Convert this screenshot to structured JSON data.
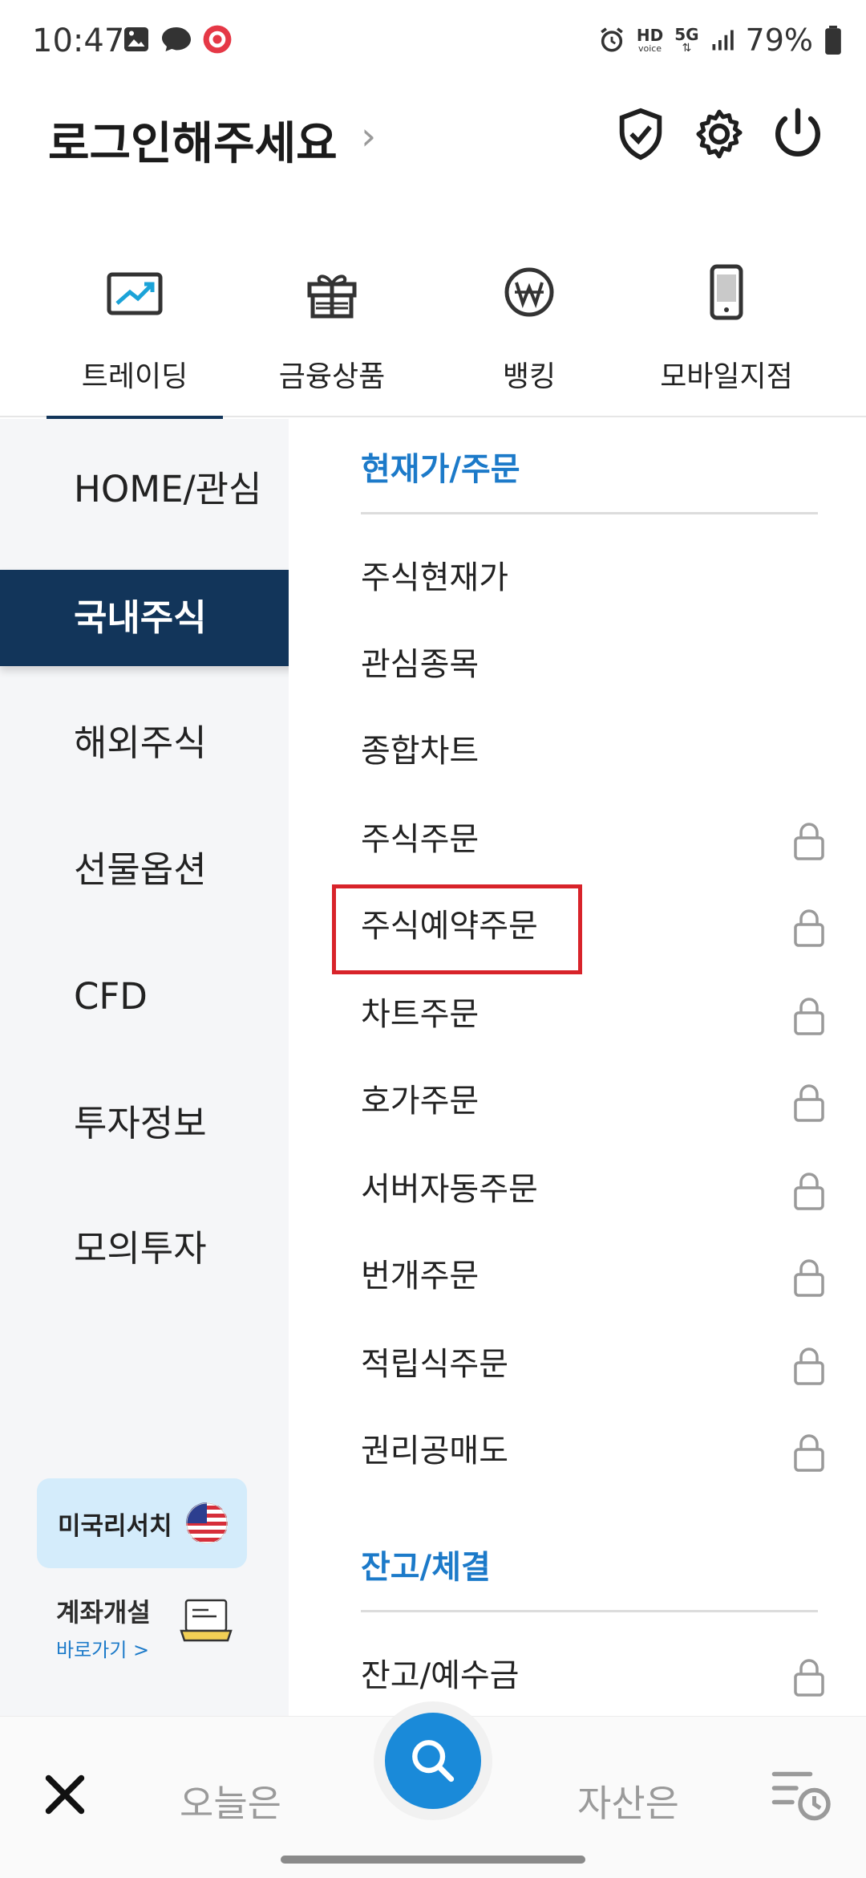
{
  "status_bar": {
    "time": "10:47",
    "battery": "79%",
    "hd_label": "HD",
    "voice_label": "voice",
    "net_label": "5G"
  },
  "header": {
    "title": "로그인해주세요"
  },
  "category_tabs": [
    {
      "label": "트레이딩",
      "icon": "trading-chart-icon"
    },
    {
      "label": "금융상품",
      "icon": "gift-icon"
    },
    {
      "label": "뱅킹",
      "icon": "won-coin-icon"
    },
    {
      "label": "모바일지점",
      "icon": "mobile-phone-icon"
    }
  ],
  "left_nav": [
    {
      "label": "HOME/관심"
    },
    {
      "label": "국내주식"
    },
    {
      "label": "해외주식"
    },
    {
      "label": "선물옵션"
    },
    {
      "label": "CFD"
    },
    {
      "label": "투자정보"
    },
    {
      "label": "모의투자"
    }
  ],
  "promo": {
    "label": "미국리서치"
  },
  "account_open": {
    "title": "계좌개설",
    "subtitle": "바로가기 >"
  },
  "menu_sections": [
    {
      "title": "현재가/주문",
      "items": [
        {
          "label": "주식현재가",
          "locked": false
        },
        {
          "label": "관심종목",
          "locked": false
        },
        {
          "label": "종합차트",
          "locked": false
        },
        {
          "label": "주식주문",
          "locked": true
        },
        {
          "label": "주식예약주문",
          "locked": true
        },
        {
          "label": "차트주문",
          "locked": true
        },
        {
          "label": "호가주문",
          "locked": true
        },
        {
          "label": "서버자동주문",
          "locked": true
        },
        {
          "label": "번개주문",
          "locked": true
        },
        {
          "label": "적립식주문",
          "locked": true
        },
        {
          "label": "권리공매도",
          "locked": true
        }
      ]
    },
    {
      "title": "잔고/체결",
      "items": [
        {
          "label": "잔고/예수금",
          "locked": true
        }
      ]
    }
  ],
  "bottom_bar": {
    "left_text": "오늘은",
    "right_text": "자산은"
  },
  "colors": {
    "navy": "#12355a",
    "accent_blue": "#1c7ac9",
    "search_blue": "#1a8ad9",
    "highlight_red": "#d8232a"
  }
}
